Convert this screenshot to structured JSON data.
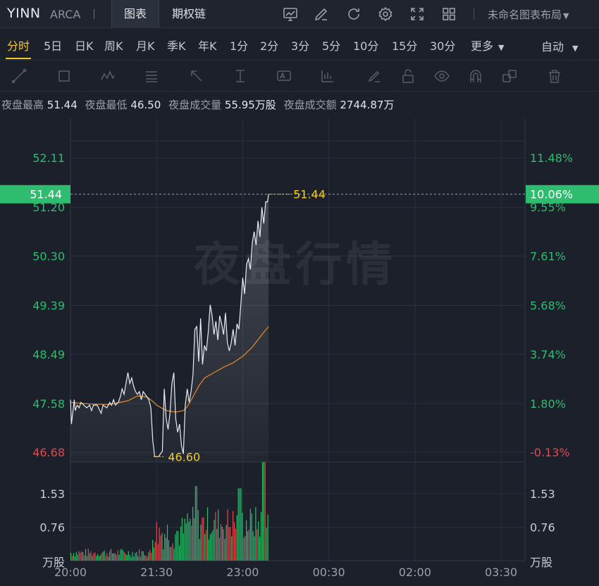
{
  "header": {
    "symbol": "YINN",
    "exchange": "ARCA",
    "tabs": [
      {
        "label": "图表",
        "active": true
      },
      {
        "label": "期权链",
        "active": false
      }
    ],
    "icons": [
      "indicator-chart-icon",
      "draw-pen-icon",
      "refresh-icon",
      "settings-gear-icon",
      "fullscreen-icon",
      "grid-layout-icon"
    ],
    "layout_label": "未命名图表布局"
  },
  "periods": [
    "分时",
    "5日",
    "日K",
    "周K",
    "月K",
    "季K",
    "年K",
    "1分",
    "2分",
    "3分",
    "5分",
    "10分",
    "15分",
    "30分",
    "更多"
  ],
  "active_period": "分时",
  "auto_label": "自动",
  "stats": [
    {
      "label": "夜盘最高",
      "value": "51.44"
    },
    {
      "label": "夜盘最低",
      "value": "46.50"
    },
    {
      "label": "夜盘成交量",
      "value": "55.95万股"
    },
    {
      "label": "夜盘成交额",
      "value": "2744.87万"
    }
  ],
  "watermark": "夜盘行情",
  "colors": {
    "up": "#2ebd6f",
    "down": "#e5484d",
    "accent": "#f3cc2a",
    "price_line": "#e8ebef",
    "avg_line": "#e58a2a",
    "current_tag": "#2ebd6f"
  },
  "chart_data": {
    "type": "line",
    "price_axis": {
      "left_ticks": [
        "52.11",
        "51.20",
        "50.30",
        "49.39",
        "48.49",
        "47.58",
        "46.68"
      ],
      "right_ticks": [
        "11.48%",
        "9.55%",
        "7.61%",
        "5.68%",
        "3.74%",
        "1.80%",
        "-0.13%"
      ],
      "ylim": [
        46.5,
        52.45
      ]
    },
    "current_price": "51.44",
    "current_pct": "10.06%",
    "low_label": "46.60",
    "high_label": "51.44",
    "x_ticks": [
      "20:00",
      "21:30",
      "23:00",
      "00:30",
      "02:00",
      "03:30"
    ],
    "x_minutes": [
      0,
      90,
      180,
      270,
      360,
      450
    ],
    "x_range": [
      0,
      475
    ],
    "price_series": [
      [
        0,
        47.65
      ],
      [
        1,
        47.2
      ],
      [
        2,
        47.35
      ],
      [
        3,
        47.5
      ],
      [
        4,
        47.65
      ],
      [
        5,
        47.45
      ],
      [
        7,
        47.55
      ],
      [
        9,
        47.5
      ],
      [
        11,
        47.6
      ],
      [
        14,
        47.55
      ],
      [
        17,
        47.5
      ],
      [
        20,
        47.55
      ],
      [
        22,
        47.45
      ],
      [
        24,
        47.55
      ],
      [
        28,
        47.55
      ],
      [
        32,
        47.4
      ],
      [
        34,
        47.55
      ],
      [
        38,
        47.5
      ],
      [
        41,
        47.6
      ],
      [
        43,
        47.55
      ],
      [
        45,
        47.65
      ],
      [
        47,
        47.55
      ],
      [
        50,
        47.6
      ],
      [
        52,
        47.7
      ],
      [
        54,
        47.85
      ],
      [
        56,
        47.75
      ],
      [
        58,
        47.95
      ],
      [
        60,
        48.15
      ],
      [
        62,
        47.95
      ],
      [
        64,
        48.05
      ],
      [
        66,
        47.9
      ],
      [
        68,
        47.8
      ],
      [
        70,
        47.75
      ],
      [
        72,
        47.8
      ],
      [
        74,
        47.65
      ],
      [
        76,
        47.8
      ],
      [
        78,
        47.75
      ],
      [
        80,
        47.7
      ],
      [
        82,
        47.65
      ],
      [
        84,
        47.5
      ],
      [
        86,
        46.9
      ],
      [
        88,
        46.6
      ],
      [
        90,
        46.6
      ],
      [
        92,
        46.6
      ],
      [
        94,
        46.65
      ],
      [
        96,
        46.7
      ],
      [
        98,
        47.85
      ],
      [
        100,
        47.3
      ],
      [
        102,
        47.1
      ],
      [
        104,
        47.4
      ],
      [
        106,
        47.95
      ],
      [
        108,
        48.15
      ],
      [
        110,
        47.3
      ],
      [
        112,
        47.05
      ],
      [
        114,
        47.2
      ],
      [
        116,
        46.8
      ],
      [
        118,
        46.65
      ],
      [
        120,
        47.55
      ],
      [
        122,
        47.85
      ],
      [
        124,
        47.6
      ],
      [
        126,
        47.8
      ],
      [
        128,
        48.1
      ],
      [
        130,
        48.95
      ],
      [
        132,
        49.0
      ],
      [
        134,
        48.35
      ],
      [
        136,
        49.15
      ],
      [
        138,
        48.3
      ],
      [
        140,
        48.65
      ],
      [
        142,
        48.55
      ],
      [
        144,
        48.9
      ],
      [
        146,
        49.4
      ],
      [
        148,
        49.2
      ],
      [
        150,
        48.85
      ],
      [
        152,
        49.1
      ],
      [
        154,
        48.75
      ],
      [
        156,
        49.2
      ],
      [
        158,
        49.05
      ],
      [
        160,
        48.85
      ],
      [
        162,
        49.25
      ],
      [
        164,
        48.7
      ],
      [
        166,
        48.55
      ],
      [
        168,
        48.7
      ],
      [
        170,
        48.95
      ],
      [
        172,
        48.65
      ],
      [
        174,
        49.05
      ],
      [
        176,
        48.95
      ],
      [
        178,
        49.4
      ],
      [
        180,
        49.9
      ],
      [
        182,
        49.6
      ],
      [
        184,
        50.15
      ],
      [
        186,
        50.25
      ],
      [
        188,
        50.05
      ],
      [
        190,
        50.55
      ],
      [
        192,
        50.75
      ],
      [
        194,
        50.5
      ],
      [
        196,
        50.95
      ],
      [
        198,
        50.65
      ],
      [
        200,
        51.2
      ],
      [
        202,
        50.9
      ],
      [
        204,
        51.3
      ],
      [
        206,
        51.3
      ],
      [
        207,
        51.44
      ]
    ],
    "avg_series": [
      [
        0,
        47.6
      ],
      [
        20,
        47.57
      ],
      [
        40,
        47.56
      ],
      [
        60,
        47.63
      ],
      [
        70,
        47.72
      ],
      [
        80,
        47.7
      ],
      [
        86,
        47.62
      ],
      [
        90,
        47.55
      ],
      [
        100,
        47.45
      ],
      [
        110,
        47.42
      ],
      [
        118,
        47.45
      ],
      [
        122,
        47.52
      ],
      [
        128,
        47.7
      ],
      [
        134,
        47.9
      ],
      [
        140,
        48.05
      ],
      [
        150,
        48.15
      ],
      [
        160,
        48.25
      ],
      [
        170,
        48.33
      ],
      [
        180,
        48.45
      ],
      [
        190,
        48.62
      ],
      [
        200,
        48.85
      ],
      [
        207,
        49.0
      ]
    ],
    "volume_axis": {
      "ticks": [
        "1.53",
        "0.76"
      ],
      "tick_values": [
        1.53,
        0.76
      ],
      "unit": "万股",
      "ylim": [
        0,
        2.25
      ]
    }
  }
}
